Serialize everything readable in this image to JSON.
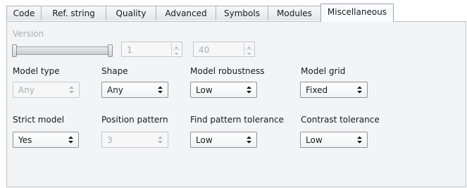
{
  "tabs": [
    {
      "label": "Code",
      "active": false
    },
    {
      "label": "Ref. string",
      "active": false
    },
    {
      "label": "Quality",
      "active": false
    },
    {
      "label": "Advanced",
      "active": false
    },
    {
      "label": "Symbols",
      "active": false
    },
    {
      "label": "Modules",
      "active": false
    },
    {
      "label": "Miscellaneous",
      "active": true
    }
  ],
  "version": {
    "label": "Version",
    "min_value": "1",
    "max_value": "40",
    "enabled": false
  },
  "row1": {
    "model_type": {
      "label": "Model type",
      "value": "Any",
      "enabled": false
    },
    "shape": {
      "label": "Shape",
      "value": "Any",
      "enabled": true
    },
    "model_robustness": {
      "label": "Model robustness",
      "value": "Low",
      "enabled": true
    },
    "model_grid": {
      "label": "Model grid",
      "value": "Fixed",
      "enabled": true
    }
  },
  "row2": {
    "strict_model": {
      "label": "Strict model",
      "value": "Yes",
      "enabled": true
    },
    "position_pattern": {
      "label": "Position pattern",
      "value": "3",
      "enabled": false
    },
    "find_pattern_tolerance": {
      "label": "Find pattern tolerance",
      "value": "Low",
      "enabled": true
    },
    "contrast_tolerance": {
      "label": "Contrast tolerance",
      "value": "Low",
      "enabled": true
    }
  },
  "colors": {
    "panel_bg": "#f3f4f5",
    "disabled_text": "#a9aeb3",
    "border": "#8e9399"
  }
}
